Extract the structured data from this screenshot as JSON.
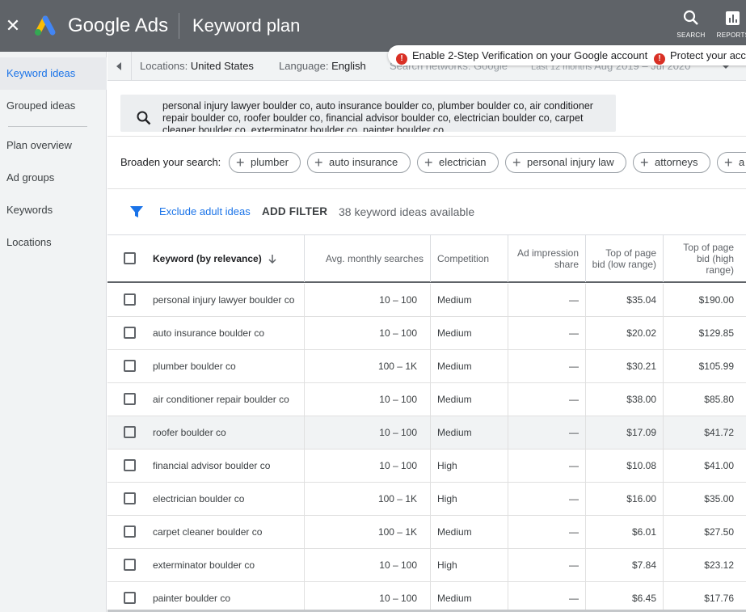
{
  "header": {
    "brand": "Google Ads",
    "title": "Keyword plan",
    "search_label": "SEARCH",
    "reports_label": "REPORTS"
  },
  "banner": {
    "message_1": "Enable 2-Step Verification on your Google account",
    "message_2": "Protect your acc"
  },
  "sidebar": {
    "items": [
      {
        "label": "Keyword ideas"
      },
      {
        "label": "Grouped ideas"
      },
      {
        "label": "Plan overview"
      },
      {
        "label": "Ad groups"
      },
      {
        "label": "Keywords"
      },
      {
        "label": "Locations"
      }
    ]
  },
  "filters": {
    "locations_key": "Locations:",
    "locations_value": "United States",
    "language_key": "Language:",
    "language_value": "English",
    "networks_key": "Search networks:",
    "networks_value": "Google",
    "period_key": "Last 12 months",
    "period_value": "Aug 2019 – Jul 2020"
  },
  "search": {
    "query": "personal injury lawyer boulder co, auto insurance boulder co, plumber boulder co, air conditioner repair boulder co, roofer boulder co, financial advisor boulder co, electrician boulder co, carpet cleaner boulder co, exterminator boulder co, painter boulder co"
  },
  "broaden": {
    "label": "Broaden your search:",
    "chips": [
      "plumber",
      "auto insurance",
      "electrician",
      "personal injury law",
      "attorneys",
      "a"
    ]
  },
  "toolbar": {
    "exclude_label": "Exclude adult ideas",
    "add_filter_label": "ADD FILTER",
    "count_text": "38 keyword ideas available"
  },
  "table": {
    "headers": {
      "keyword": "Keyword (by relevance)",
      "searches": "Avg. monthly searches",
      "competition": "Competition",
      "impression_share": "Ad impression share",
      "bid_low": "Top of page bid (low range)",
      "bid_high": "Top of page bid (high range)"
    },
    "rows": [
      {
        "keyword": "personal injury lawyer boulder co",
        "searches": "10 – 100",
        "competition": "Medium",
        "impression": "—",
        "low": "$35.04",
        "high": "$190.00"
      },
      {
        "keyword": "auto insurance boulder co",
        "searches": "10 – 100",
        "competition": "Medium",
        "impression": "—",
        "low": "$20.02",
        "high": "$129.85"
      },
      {
        "keyword": "plumber boulder co",
        "searches": "100 – 1K",
        "competition": "Medium",
        "impression": "—",
        "low": "$30.21",
        "high": "$105.99"
      },
      {
        "keyword": "air conditioner repair boulder co",
        "searches": "10 – 100",
        "competition": "Medium",
        "impression": "—",
        "low": "$38.00",
        "high": "$85.80"
      },
      {
        "keyword": "roofer boulder co",
        "searches": "10 – 100",
        "competition": "Medium",
        "impression": "—",
        "low": "$17.09",
        "high": "$41.72"
      },
      {
        "keyword": "financial advisor boulder co",
        "searches": "10 – 100",
        "competition": "High",
        "impression": "—",
        "low": "$10.08",
        "high": "$41.00"
      },
      {
        "keyword": "electrician boulder co",
        "searches": "100 – 1K",
        "competition": "High",
        "impression": "—",
        "low": "$16.00",
        "high": "$35.00"
      },
      {
        "keyword": "carpet cleaner boulder co",
        "searches": "100 – 1K",
        "competition": "Medium",
        "impression": "—",
        "low": "$6.01",
        "high": "$27.50"
      },
      {
        "keyword": "exterminator boulder co",
        "searches": "10 – 100",
        "competition": "High",
        "impression": "—",
        "low": "$7.84",
        "high": "$23.12"
      },
      {
        "keyword": "painter boulder co",
        "searches": "10 – 100",
        "competition": "Medium",
        "impression": "—",
        "low": "$6.45",
        "high": "$17.76"
      }
    ]
  },
  "colors": {
    "header_bg": "#5f6368",
    "accent": "#1a73e8",
    "alert": "#d93025"
  }
}
